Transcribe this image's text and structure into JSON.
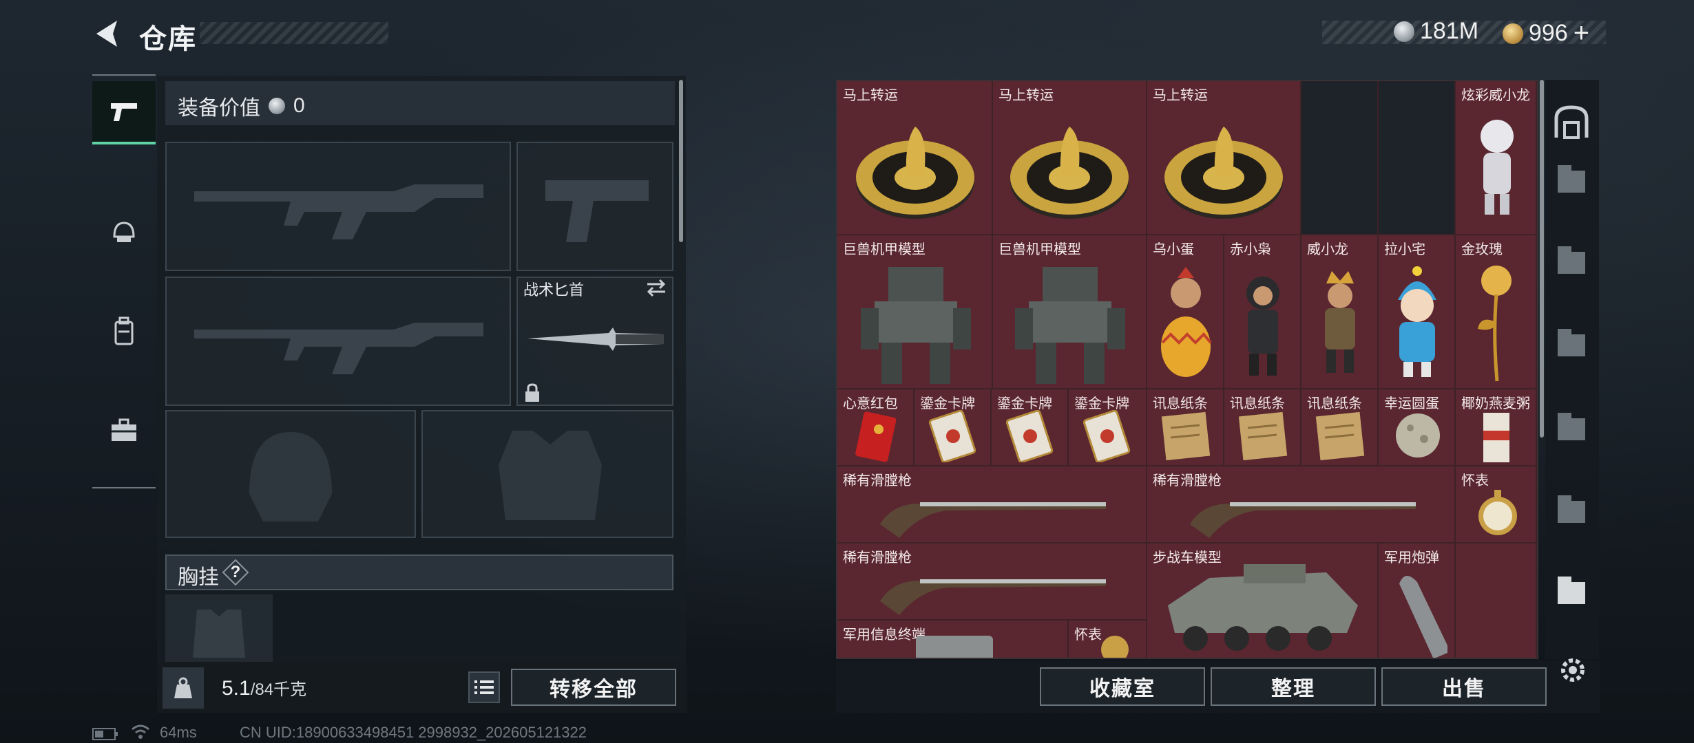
{
  "header": {
    "title": "仓库"
  },
  "currency": {
    "silver": "181M",
    "gold": "996",
    "plus": "+"
  },
  "equipment": {
    "label": "装备价值",
    "value": "0",
    "knife_label": "战术匕首",
    "chest_label": "胸挂",
    "help": "?"
  },
  "weight": {
    "current": "5.1",
    "max": "/84千克"
  },
  "buttons": {
    "transfer_all": "转移全部",
    "collection": "收藏室",
    "organize": "整理",
    "sell": "出售"
  },
  "stash_items": [
    {
      "label": "马上转运",
      "icon": "lucky-compass"
    },
    {
      "label": "马上转运",
      "icon": "lucky-compass"
    },
    {
      "label": "马上转运",
      "icon": "lucky-compass"
    },
    {
      "label": "炫彩威小龙",
      "icon": "figurine"
    },
    {
      "label": "巨兽机甲模型",
      "icon": "mech-model"
    },
    {
      "label": "巨兽机甲模型",
      "icon": "mech-model"
    },
    {
      "label": "乌小蛋",
      "icon": "figurine"
    },
    {
      "label": "赤小枭",
      "icon": "figurine"
    },
    {
      "label": "威小龙",
      "icon": "figurine"
    },
    {
      "label": "拉小宅",
      "icon": "figurine"
    },
    {
      "label": "金玫瑰",
      "icon": "gold-rose"
    },
    {
      "label": "心意红包",
      "icon": "red-envelope"
    },
    {
      "label": "鎏金卡牌",
      "icon": "card"
    },
    {
      "label": "鎏金卡牌",
      "icon": "card"
    },
    {
      "label": "鎏金卡牌",
      "icon": "card"
    },
    {
      "label": "讯息纸条",
      "icon": "paper-note"
    },
    {
      "label": "讯息纸条",
      "icon": "paper-note"
    },
    {
      "label": "讯息纸条",
      "icon": "paper-note"
    },
    {
      "label": "幸运圆蛋",
      "icon": "egg"
    },
    {
      "label": "椰奶燕麦粥",
      "icon": "drink-box"
    },
    {
      "label": "稀有滑膛枪",
      "icon": "musket"
    },
    {
      "label": "稀有滑膛枪",
      "icon": "musket"
    },
    {
      "label": "怀表",
      "icon": "pocket-watch"
    },
    {
      "label": "稀有滑膛枪",
      "icon": "musket"
    },
    {
      "label": "步战车模型",
      "icon": "ifv-model"
    },
    {
      "label": "军用炮弹",
      "icon": "shell"
    },
    {
      "label": "军用信息终端",
      "icon": "terminal"
    },
    {
      "label": "怀表",
      "icon": "pocket-watch"
    }
  ],
  "status": {
    "ping": "64ms",
    "uid": "CN UID:18900633498451 2998932_202605121322"
  }
}
